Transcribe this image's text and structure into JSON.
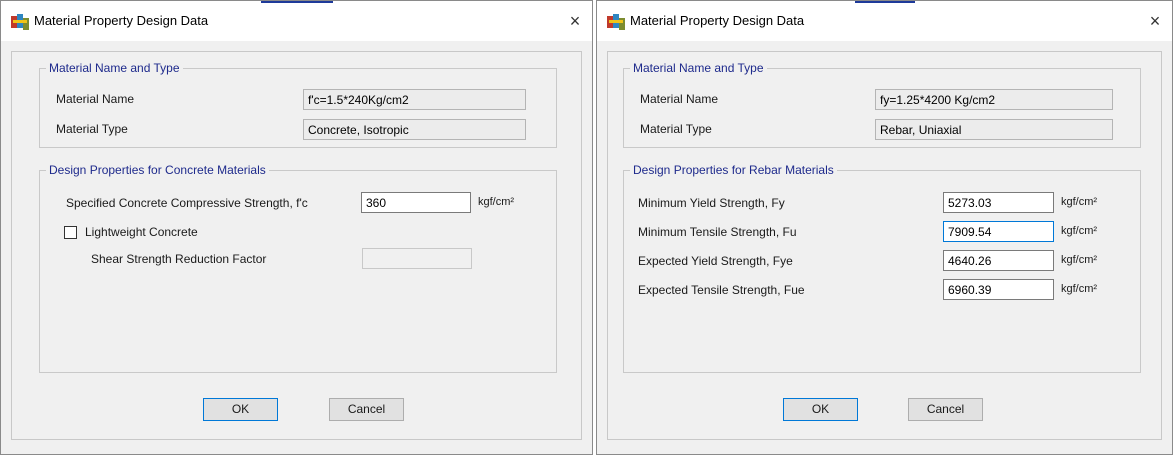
{
  "left": {
    "title": "Material Property Design Data",
    "close": "×",
    "name_type_group": {
      "legend": "Material Name and Type",
      "name_label": "Material Name",
      "name_value": "f'c=1.5*240Kg/cm2",
      "type_label": "Material Type",
      "type_value": "Concrete, Isotropic"
    },
    "design_group": {
      "legend": "Design Properties for Concrete Materials",
      "fc_label": "Specified Concrete Compressive Strength, f'c",
      "fc_value": "360",
      "fc_unit": "kgf/cm²",
      "lightweight_label": "Lightweight Concrete",
      "lightweight_checked": false,
      "shear_label": "Shear Strength Reduction Factor",
      "shear_value": ""
    },
    "ok": "OK",
    "cancel": "Cancel"
  },
  "right": {
    "title": "Material Property Design Data",
    "close": "×",
    "name_type_group": {
      "legend": "Material Name and Type",
      "name_label": "Material Name",
      "name_value": "fy=1.25*4200 Kg/cm2",
      "type_label": "Material Type",
      "type_value": "Rebar, Uniaxial"
    },
    "design_group": {
      "legend": "Design Properties for Rebar Materials",
      "fields": [
        {
          "label": "Minimum Yield Strength, Fy",
          "value": "5273.03",
          "unit": "kgf/cm²"
        },
        {
          "label": "Minimum Tensile Strength, Fu",
          "value": "7909.54",
          "unit": "kgf/cm²"
        },
        {
          "label": "Expected Yield Strength, Fye",
          "value": "4640.26",
          "unit": "kgf/cm²"
        },
        {
          "label": "Expected Tensile Strength, Fue",
          "value": "6960.39",
          "unit": "kgf/cm²"
        }
      ]
    },
    "ok": "OK",
    "cancel": "Cancel"
  },
  "icons": {
    "title_icon": "app-icon",
    "close_icon": "close-icon",
    "checkbox": "checkbox-icon"
  },
  "colors": {
    "legend_text": "#1e2a8c",
    "focus_border": "#0078d7",
    "title_accent": "#1e3a9a"
  }
}
